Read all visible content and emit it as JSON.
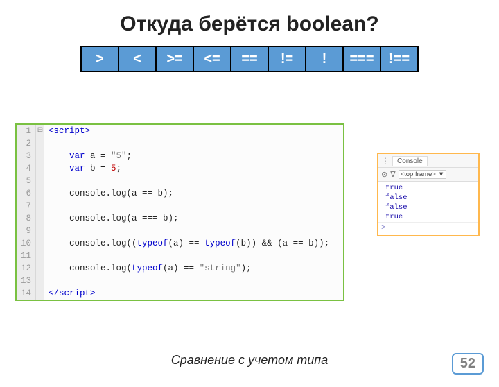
{
  "title": "Откуда берётся boolean?",
  "operators": [
    ">",
    "<",
    ">=",
    "<=",
    "==",
    "!=",
    "!",
    "===",
    "!=="
  ],
  "code": {
    "lines": [
      {
        "n": "1",
        "marker": "⊟",
        "html": "<span class='tag'>&lt;script&gt;</span>"
      },
      {
        "n": "2",
        "marker": "",
        "html": ""
      },
      {
        "n": "3",
        "marker": "",
        "html": "    <span class='kw'>var</span> a = <span class='str'>\"5\"</span>;"
      },
      {
        "n": "4",
        "marker": "",
        "html": "    <span class='kw'>var</span> b = <span class='num'>5</span>;"
      },
      {
        "n": "5",
        "marker": "",
        "html": ""
      },
      {
        "n": "6",
        "marker": "",
        "html": "    console.log(a == b);"
      },
      {
        "n": "7",
        "marker": "",
        "html": ""
      },
      {
        "n": "8",
        "marker": "",
        "html": "    console.log(a === b);"
      },
      {
        "n": "9",
        "marker": "",
        "html": ""
      },
      {
        "n": "10",
        "marker": "",
        "html": "    console.log((<span class='kw2'>typeof</span>(a) == <span class='kw2'>typeof</span>(b)) &amp;&amp; (a == b));"
      },
      {
        "n": "11",
        "marker": "",
        "html": ""
      },
      {
        "n": "12",
        "marker": "",
        "html": "    console.log(<span class='kw2'>typeof</span>(a) == <span class='str'>\"string\"</span>);"
      },
      {
        "n": "13",
        "marker": "",
        "html": ""
      },
      {
        "n": "14",
        "marker": "",
        "html": "<span class='tag'>&lt;/script&gt;</span>"
      }
    ]
  },
  "console": {
    "tab": "Console",
    "frame": "<top frame>",
    "output": [
      "true",
      "false",
      "false",
      "true"
    ],
    "prompt": ">"
  },
  "caption": "Сравнение с учетом типа",
  "page": "52"
}
